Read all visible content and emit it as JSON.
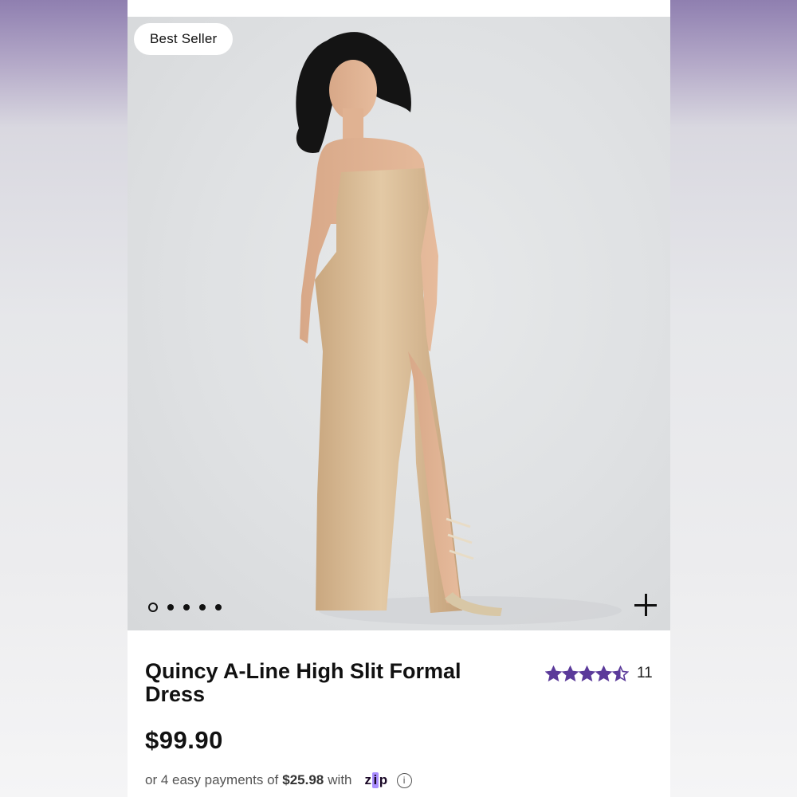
{
  "product": {
    "badge": "Best Seller",
    "title": "Quincy A-Line High Slit Formal Dress",
    "rating_value": 4.5,
    "rating_count": "11",
    "price": "$99.90",
    "payments": {
      "prefix": "or 4 easy payments of",
      "amount": "$25.98",
      "suffix": "with",
      "provider": "zip",
      "provider_icon": "zip-logo",
      "info_icon": "info-icon"
    }
  },
  "gallery": {
    "image_count": 5,
    "active_index": 0,
    "image_alt_icon": "dress-photo"
  },
  "colors": {
    "star": "#5b3a9a",
    "dress": "#d9bd98",
    "backdrop": "#dfe1e3"
  }
}
